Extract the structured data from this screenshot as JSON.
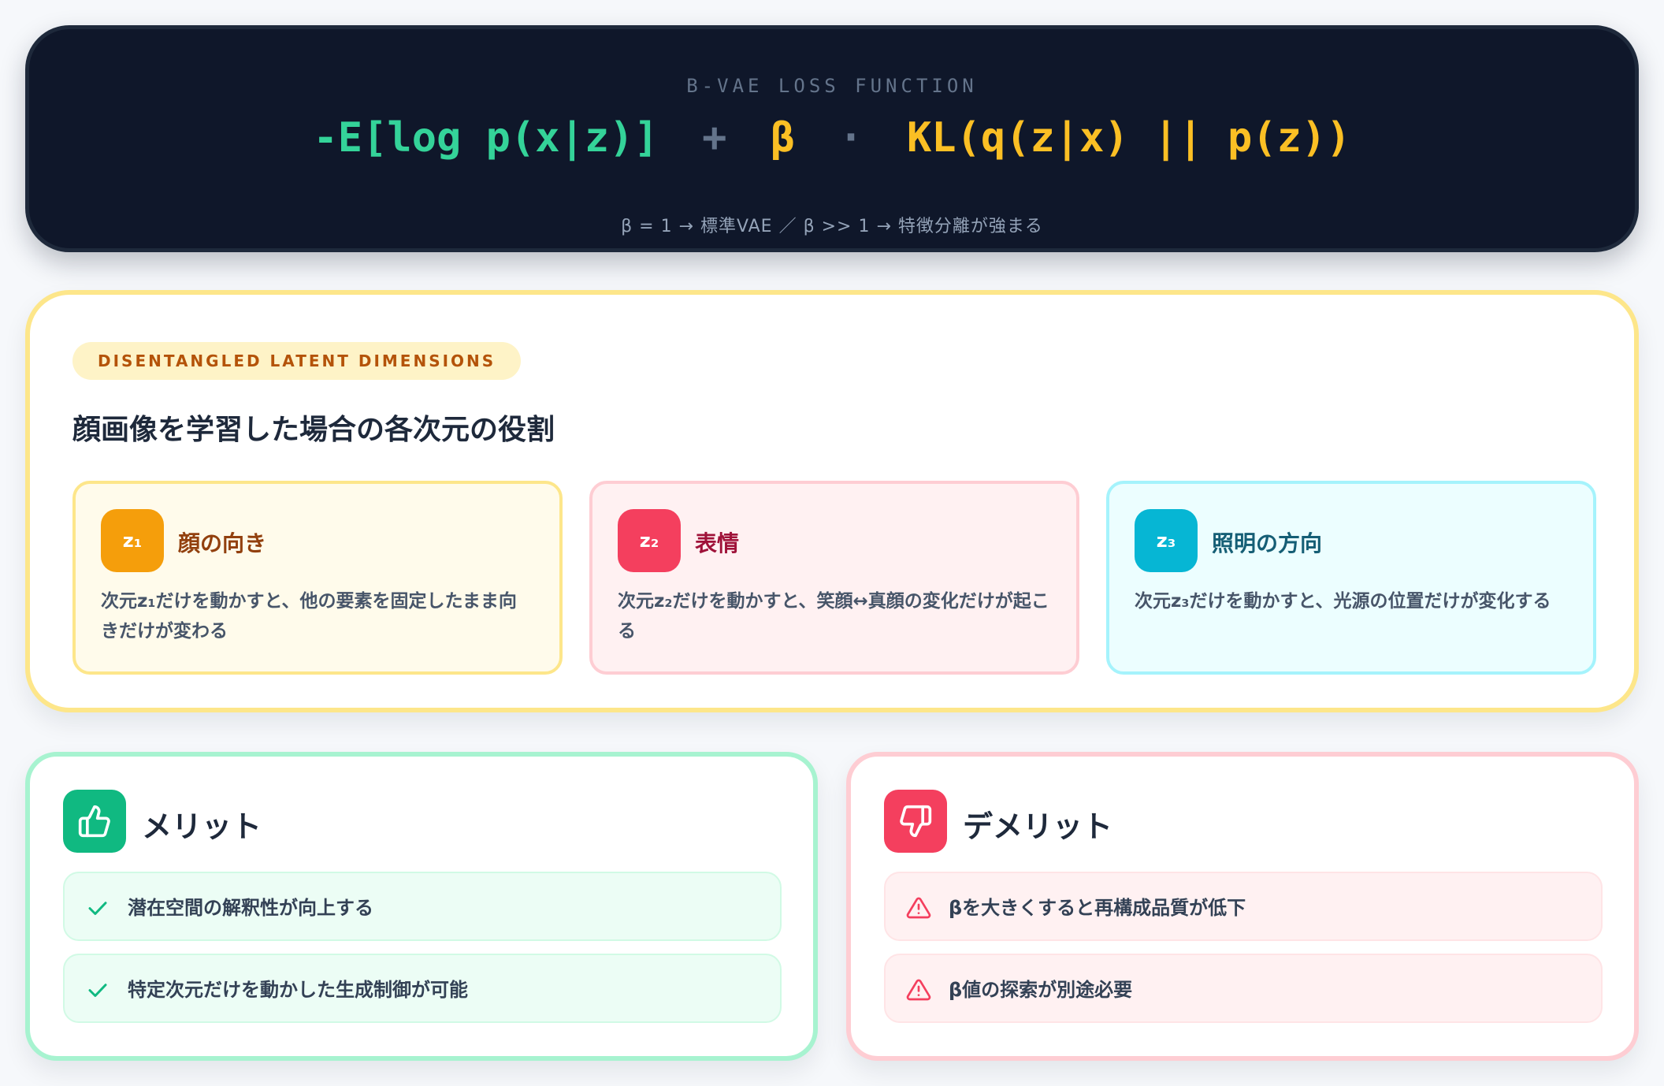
{
  "formula": {
    "label": "Β-VAE LOSS FUNCTION",
    "reconstruction": "-E[log p(x|z)]",
    "plus": "+",
    "beta": "β",
    "dot": "·",
    "kl": "KL(q(z|x) || p(z))",
    "note": "β = 1 → 標準VAE ／ β >> 1 → 特徴分離が強まる"
  },
  "dimensions": {
    "tag": "DISENTANGLED LATENT DIMENSIONS",
    "title": "顔画像を学習した場合の各次元の役割",
    "cards": [
      {
        "badge": "z₁",
        "name": "顔の向き",
        "description": "次元z₁だけを動かすと、他の要素を固定したまま向きだけが変わる",
        "color": "#f59e0b"
      },
      {
        "badge": "z₂",
        "name": "表情",
        "description": "次元z₂だけを動かすと、笑顔↔真顔の変化だけが起こる",
        "color": "#f43f5e"
      },
      {
        "badge": "z₃",
        "name": "照明の方向",
        "description": "次元z₃だけを動かすと、光源の位置だけが変化する",
        "color": "#06b6d4"
      }
    ]
  },
  "pros": {
    "title": "メリット",
    "icon": "thumbs-up-icon",
    "items": [
      "潜在空間の解釈性が向上する",
      "特定次元だけを動かした生成制御が可能"
    ]
  },
  "cons": {
    "title": "デメリット",
    "icon": "thumbs-down-icon",
    "items": [
      "βを大きくすると再構成品質が低下",
      "β値の探索が別途必要"
    ]
  }
}
